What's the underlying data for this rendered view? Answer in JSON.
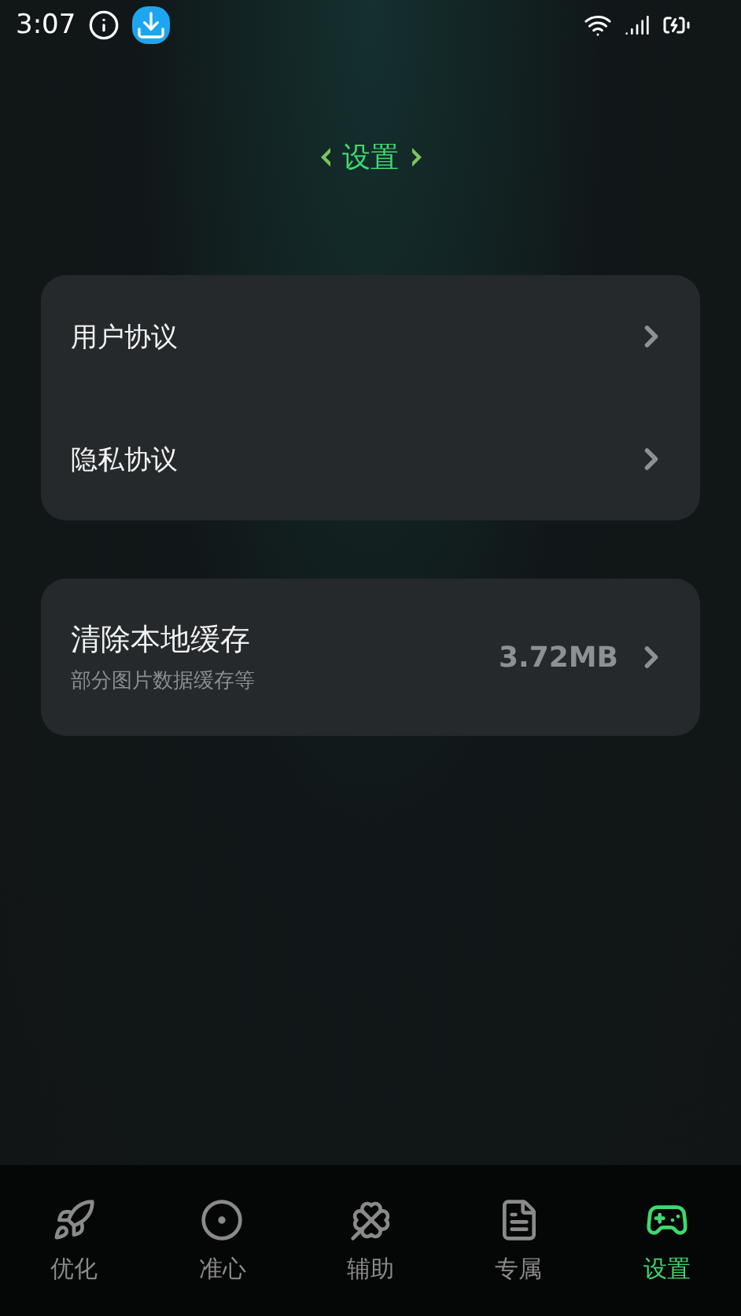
{
  "status_bar": {
    "time": "3:07"
  },
  "title": "设置",
  "groups": [
    {
      "items": [
        {
          "label": "用户协议"
        },
        {
          "label": "隐私协议"
        }
      ]
    },
    {
      "items": [
        {
          "label": "清除本地缓存",
          "subtitle": "部分图片数据缓存等",
          "value": "3.72MB"
        }
      ]
    }
  ],
  "tabs": [
    {
      "label": "优化",
      "selected": false
    },
    {
      "label": "准心",
      "selected": false
    },
    {
      "label": "辅助",
      "selected": false
    },
    {
      "label": "专属",
      "selected": false
    },
    {
      "label": "设置",
      "selected": true
    }
  ]
}
